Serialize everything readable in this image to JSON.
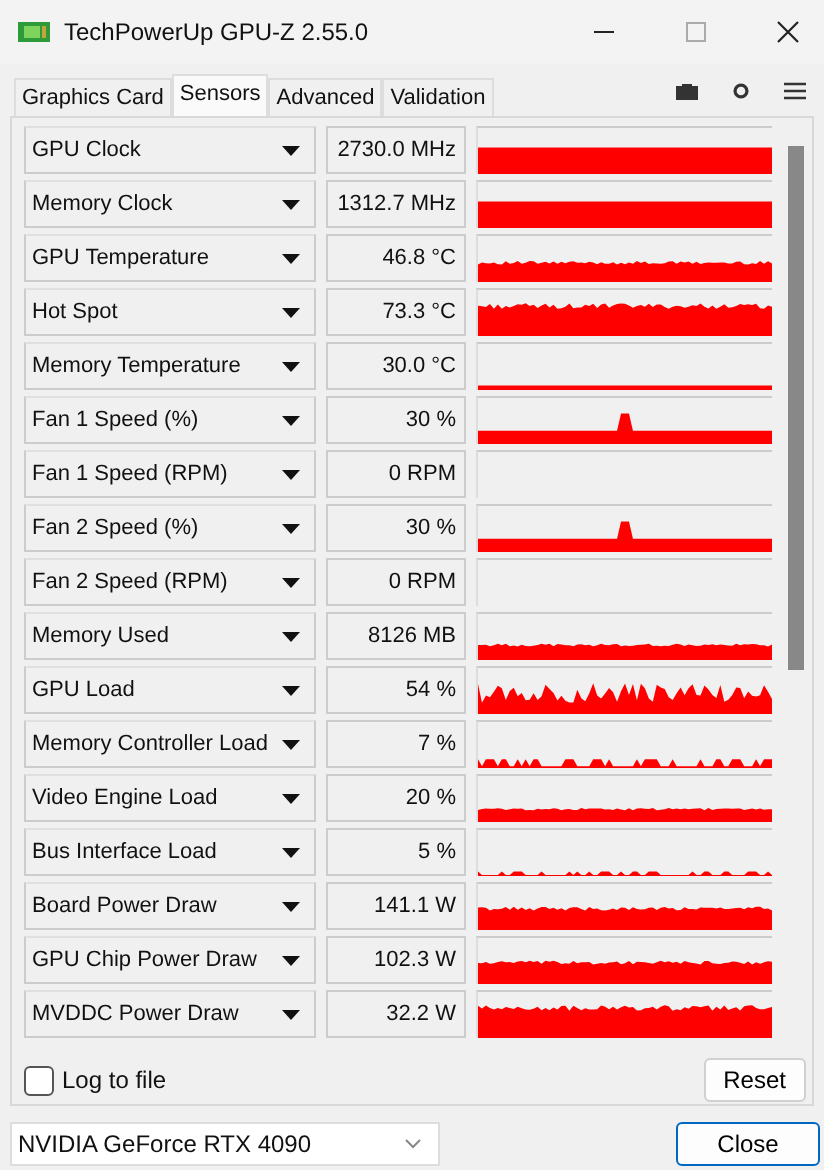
{
  "window": {
    "title": "TechPowerUp GPU-Z 2.55.0"
  },
  "tabs": [
    {
      "label": "Graphics Card",
      "selected": false
    },
    {
      "label": "Sensors",
      "selected": true
    },
    {
      "label": "Advanced",
      "selected": false
    },
    {
      "label": "Validation",
      "selected": false
    }
  ],
  "sensors": [
    {
      "name": "GPU Clock",
      "value": "2730.0 MHz"
    },
    {
      "name": "Memory Clock",
      "value": "1312.7 MHz"
    },
    {
      "name": "GPU Temperature",
      "value": "46.8 °C"
    },
    {
      "name": "Hot Spot",
      "value": "73.3 °C"
    },
    {
      "name": "Memory Temperature",
      "value": "30.0 °C"
    },
    {
      "name": "Fan 1 Speed (%)",
      "value": "30 %"
    },
    {
      "name": "Fan 1 Speed (RPM)",
      "value": "0 RPM"
    },
    {
      "name": "Fan 2 Speed (%)",
      "value": "30 %"
    },
    {
      "name": "Fan 2 Speed (RPM)",
      "value": "0 RPM"
    },
    {
      "name": "Memory Used",
      "value": "8126 MB"
    },
    {
      "name": "GPU Load",
      "value": "54 %"
    },
    {
      "name": "Memory Controller Load",
      "value": "7 %"
    },
    {
      "name": "Video Engine Load",
      "value": "20 %"
    },
    {
      "name": "Bus Interface Load",
      "value": "5 %"
    },
    {
      "name": "Board Power Draw",
      "value": "141.1 W"
    },
    {
      "name": "GPU Chip Power Draw",
      "value": "102.3 W"
    },
    {
      "name": "MVDDC Power Draw",
      "value": "32.2 W"
    }
  ],
  "log_to_file": {
    "label": "Log to file",
    "checked": false
  },
  "reset_button": "Reset",
  "gpu_select": {
    "value": "NVIDIA GeForce RTX 4090"
  },
  "close_button": "Close"
}
